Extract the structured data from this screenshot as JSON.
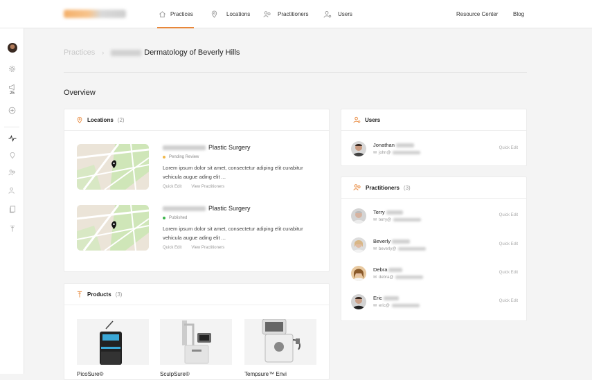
{
  "topnav": {
    "items": [
      {
        "label": "Practices",
        "icon": "home-icon"
      },
      {
        "label": "Locations",
        "icon": "map-pin-icon"
      },
      {
        "label": "Practitioners",
        "icon": "practitioners-icon"
      },
      {
        "label": "Users",
        "icon": "users-icon"
      }
    ],
    "resource_center": "Resource Center",
    "blog": "Blog",
    "accent": "#e8873a"
  },
  "sidebar": {
    "announcements_count": "25"
  },
  "breadcrumb": {
    "root": "Practices",
    "separator": "›",
    "current": "Dermatology of Beverly Hills"
  },
  "overview": {
    "title": "Overview"
  },
  "locations": {
    "title": "Locations",
    "count": "(2)",
    "items": [
      {
        "title": "Plastic Surgery",
        "status": "Pending Review",
        "status_color": "#f2b84b",
        "description": "Lorem ipsum dolor sit amet, consectetur adiping elit curabitur vehicula augue ading elit ...",
        "quick_edit": "Quick Edit",
        "view_practitioners": "View Practitioners"
      },
      {
        "title": "Plastic Surgery",
        "status": "Published",
        "status_color": "#3bb54a",
        "description": "Lorem ipsum dolor sit amet, consectetur adiping elit curabitur vehicula augue ading elit ...",
        "quick_edit": "Quick Edit",
        "view_practitioners": "View Practitioners"
      }
    ]
  },
  "products": {
    "title": "Products",
    "count": "(3)",
    "items": [
      {
        "name": "PicoSure®"
      },
      {
        "name": "SculpSure®"
      },
      {
        "name": "Tempsure™ Envi"
      }
    ]
  },
  "users": {
    "title": "Users",
    "items": [
      {
        "first": "Jonathan",
        "email": "john@",
        "quick_edit": "Quick Edit"
      }
    ]
  },
  "practitioners": {
    "title": "Practitioners",
    "count": "(3)",
    "items": [
      {
        "first": "Terry",
        "email": "terry@",
        "quick_edit": "Quick Edit"
      },
      {
        "first": "Beverly",
        "email": "beverly@",
        "quick_edit": "Quick Edit"
      },
      {
        "first": "Debra",
        "email": "debra@",
        "quick_edit": "Quick Edit"
      },
      {
        "first": "Eric",
        "email": "eric@",
        "quick_edit": "Quick Edit"
      }
    ]
  }
}
